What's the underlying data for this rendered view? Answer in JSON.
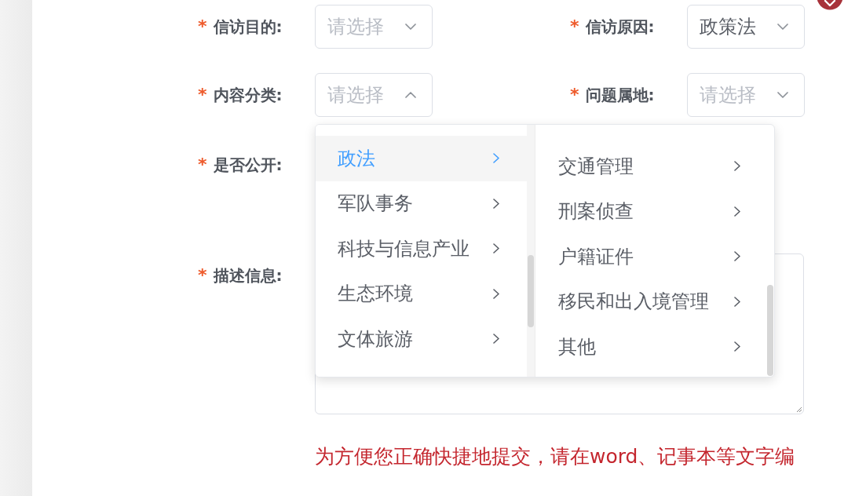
{
  "form": {
    "rows": [
      {
        "fields": [
          {
            "required_mark": "*",
            "label": "信访目的:",
            "kind": "select",
            "placeholder": "请选择",
            "open": false
          },
          {
            "required_mark": "*",
            "label": "信访原因:",
            "kind": "select",
            "value": "政策法",
            "open": false
          }
        ]
      },
      {
        "fields": [
          {
            "required_mark": "*",
            "label": "内容分类:",
            "kind": "select",
            "placeholder": "请选择",
            "open": true,
            "dropdown": {
              "columns": [
                {
                  "items": [
                    {
                      "label": "政法",
                      "selected": true,
                      "has_children": true
                    },
                    {
                      "label": "军队事务",
                      "selected": false,
                      "has_children": true
                    },
                    {
                      "label": "科技与信息产业",
                      "selected": false,
                      "has_children": true
                    },
                    {
                      "label": "生态环境",
                      "selected": false,
                      "has_children": true
                    },
                    {
                      "label": "文体旅游",
                      "selected": false,
                      "has_children": true
                    }
                  ]
                },
                {
                  "items": [
                    {
                      "label": "交通管理",
                      "selected": false,
                      "has_children": true
                    },
                    {
                      "label": "刑案侦查",
                      "selected": false,
                      "has_children": true
                    },
                    {
                      "label": "户籍证件",
                      "selected": false,
                      "has_children": true
                    },
                    {
                      "label": "移民和出入境管理",
                      "selected": false,
                      "has_children": true
                    },
                    {
                      "label": "其他",
                      "selected": false,
                      "has_children": true
                    }
                  ]
                }
              ]
            }
          },
          {
            "required_mark": "*",
            "label": "问题属地:",
            "kind": "select",
            "placeholder": "请选择",
            "open": false
          }
        ]
      },
      {
        "fields": [
          {
            "required_mark": "*",
            "label": "是否公开:",
            "kind": "covered"
          }
        ]
      },
      {
        "fields": [
          {
            "required_mark": "*",
            "label": "描述信息:",
            "kind": "textarea"
          }
        ]
      }
    ]
  },
  "hint": "为方便您正确快捷地提交，请在word、记事本等文字编"
}
